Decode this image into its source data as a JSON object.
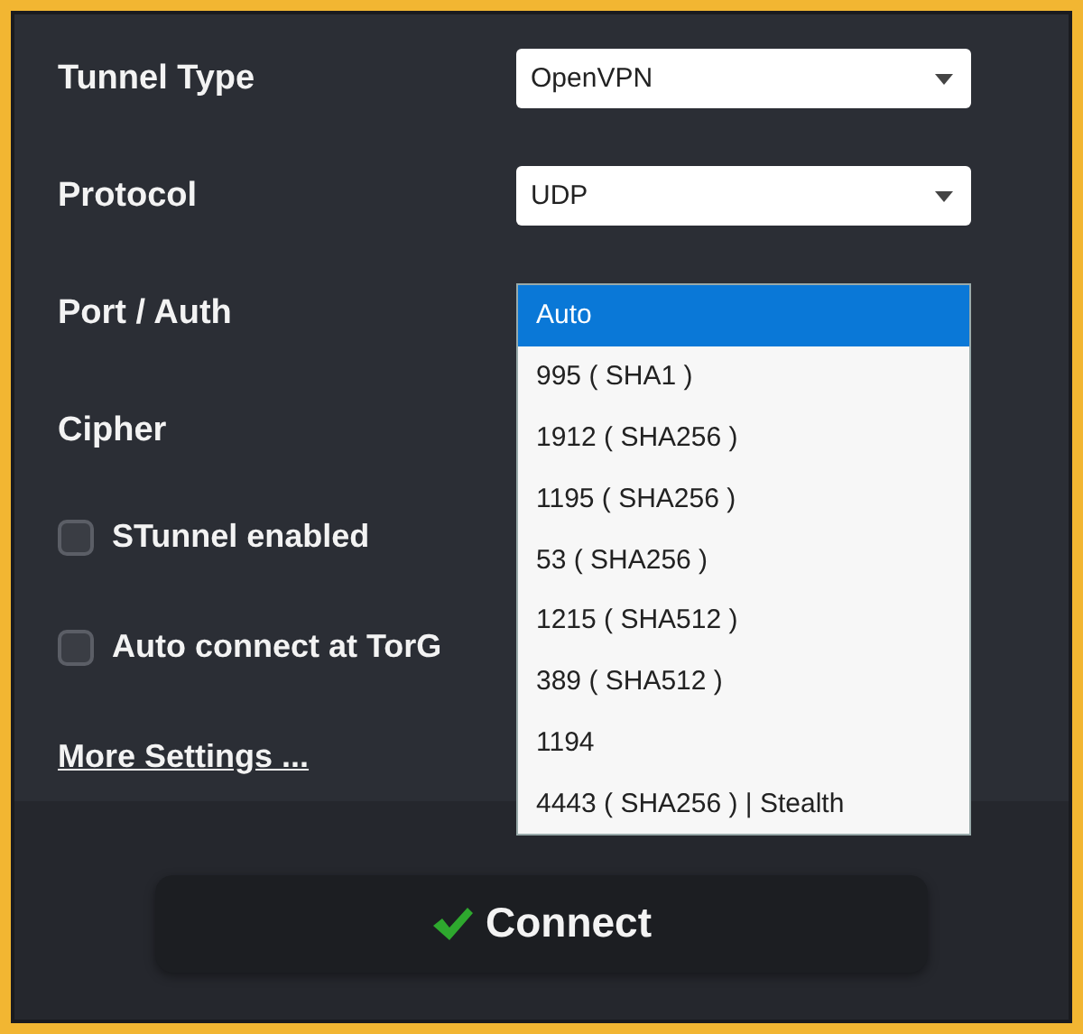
{
  "fields": [
    {
      "label": "Tunnel Type",
      "kind": "select",
      "value": "OpenVPN"
    },
    {
      "label": "Protocol",
      "kind": "select",
      "value": "UDP"
    },
    {
      "label": "Port / Auth",
      "kind": "open_list",
      "options": [
        {
          "label": "Auto",
          "selected": true
        },
        {
          "label": "995 ( SHA1 )",
          "selected": false
        },
        {
          "label": "1912 ( SHA256 )",
          "selected": false
        },
        {
          "label": "1195 ( SHA256 )",
          "selected": false
        },
        {
          "label": "53 ( SHA256 )",
          "selected": false
        },
        {
          "label": "1215 ( SHA512 )",
          "selected": false
        },
        {
          "label": "389 ( SHA512 )",
          "selected": false
        },
        {
          "label": "1194",
          "selected": false
        },
        {
          "label": "4443 ( SHA256 ) | Stealth",
          "selected": false
        }
      ]
    },
    {
      "label": "Cipher",
      "kind": "covered"
    }
  ],
  "checkboxes": [
    {
      "label": "STunnel enabled",
      "checked": false
    },
    {
      "label": "Auto connect at TorG",
      "checked": false
    }
  ],
  "link": "More Settings ...",
  "button": "Connect"
}
